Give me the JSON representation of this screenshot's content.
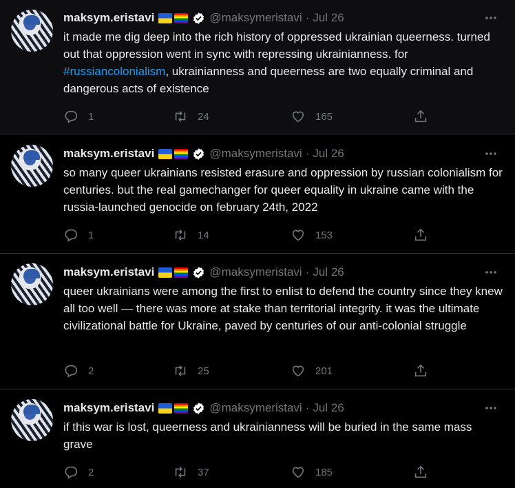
{
  "tweets": [
    {
      "name": "maksym.eristavi",
      "handle": "@maksymeristavi",
      "separator": "·",
      "date": "Jul 26",
      "text_before": "it made me dig deep into the rich history of oppressed ukrainian queerness. turned out that oppression went in sync with repressing ukrainianness. for ",
      "hashtag": "#russiancolonialism",
      "text_after": ", ukrainianness and queerness are two equally criminal and dangerous acts of existence",
      "replies": "1",
      "retweets": "24",
      "likes": "165"
    },
    {
      "name": "maksym.eristavi",
      "handle": "@maksymeristavi",
      "separator": "·",
      "date": "Jul 26",
      "text": "so many queer ukrainians resisted erasure and oppression by russian colonialism for centuries. but the real gamechanger for queer equality in ukraine came with the russia-launched genocide on february 24th, 2022",
      "replies": "1",
      "retweets": "14",
      "likes": "153"
    },
    {
      "name": "maksym.eristavi",
      "handle": "@maksymeristavi",
      "separator": "·",
      "date": "Jul 26",
      "text": "queer ukrainians were among the first to enlist to defend the country since they knew all too well — there was more at stake than territorial integrity. it was the ultimate civilizational battle for Ukraine, paved by centuries of our anti-colonial struggle",
      "replies": "2",
      "retweets": "25",
      "likes": "201"
    },
    {
      "name": "maksym.eristavi",
      "handle": "@maksymeristavi",
      "separator": "·",
      "date": "Jul 26",
      "text": "if this war is lost, queerness and ukrainianness will be buried in the same mass grave",
      "replies": "2",
      "retweets": "37",
      "likes": "185"
    }
  ],
  "colors": {
    "background": "#000000",
    "text": "#e7e9ea",
    "muted": "#71767b",
    "link": "#1d9bf0",
    "verified": "#ffffff"
  },
  "icons": [
    "reply-icon",
    "retweet-icon",
    "like-icon",
    "share-icon",
    "more-icon",
    "verified-icon"
  ]
}
